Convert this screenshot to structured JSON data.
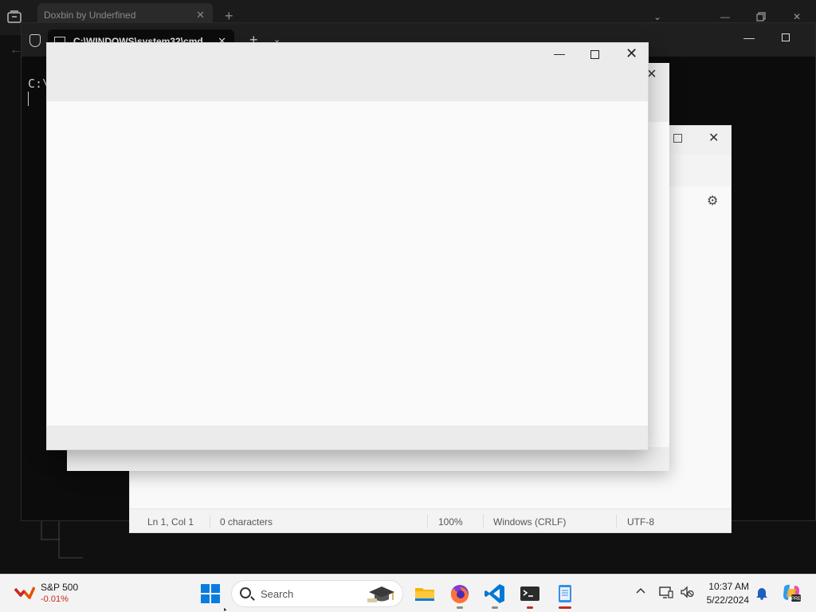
{
  "browser": {
    "tab_title": "Doxbin by Underfined",
    "tab_close": "✕",
    "new_tab": "+"
  },
  "terminal": {
    "tab_title": "C:\\WINDOWS\\system32\\cmd",
    "tab_close": "✕",
    "new_tab": "+",
    "dropdown": "⌄",
    "prompt": "C:\\"
  },
  "notepad": {
    "status": {
      "position": "Ln 1, Col 1",
      "characters": "0 characters",
      "zoom": "100%",
      "line_ending": "Windows (CRLF)",
      "encoding": "UTF-8"
    }
  },
  "taskbar": {
    "stock_name": "S&P 500",
    "stock_change": "-0.01%",
    "search_placeholder": "Search",
    "time": "10:37 AM",
    "date": "5/22/2024",
    "pinned_apps": [
      "file-explorer",
      "firefox",
      "vscode",
      "terminal",
      "notepad"
    ]
  },
  "colors": {
    "accent": "#0a7ce0",
    "stock_negative": "#c42b1c",
    "taskbar_bg": "#f3f3f3",
    "terminal_bg": "#0c0c0c"
  }
}
